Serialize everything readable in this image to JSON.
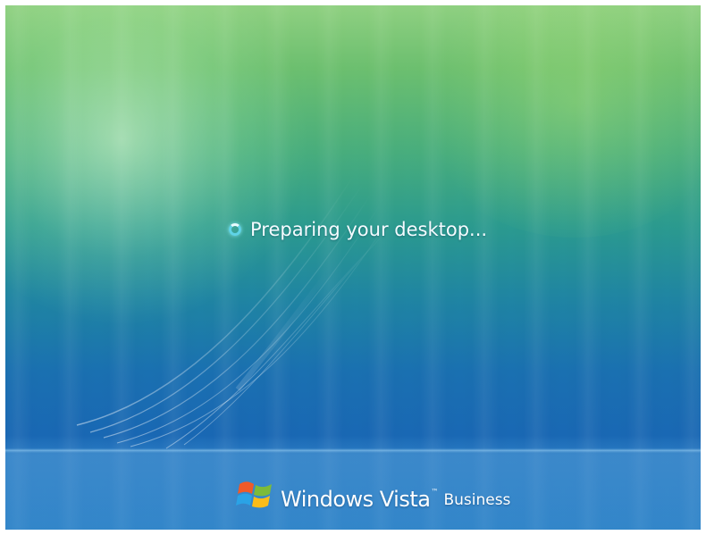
{
  "boot_screen": {
    "status_text": "Preparing your desktop...",
    "status_icon": "busy-spinner-icon",
    "logo_icon": "windows-flag-icon",
    "brand_name": "Windows Vista",
    "trademark": "™",
    "edition": "Business"
  },
  "colors": {
    "background_top": "#8fd080",
    "background_middle": "#2b9a8e",
    "background_bottom": "#1967b3",
    "spinner": "#5fd3e6",
    "text": "#f4fbff"
  }
}
